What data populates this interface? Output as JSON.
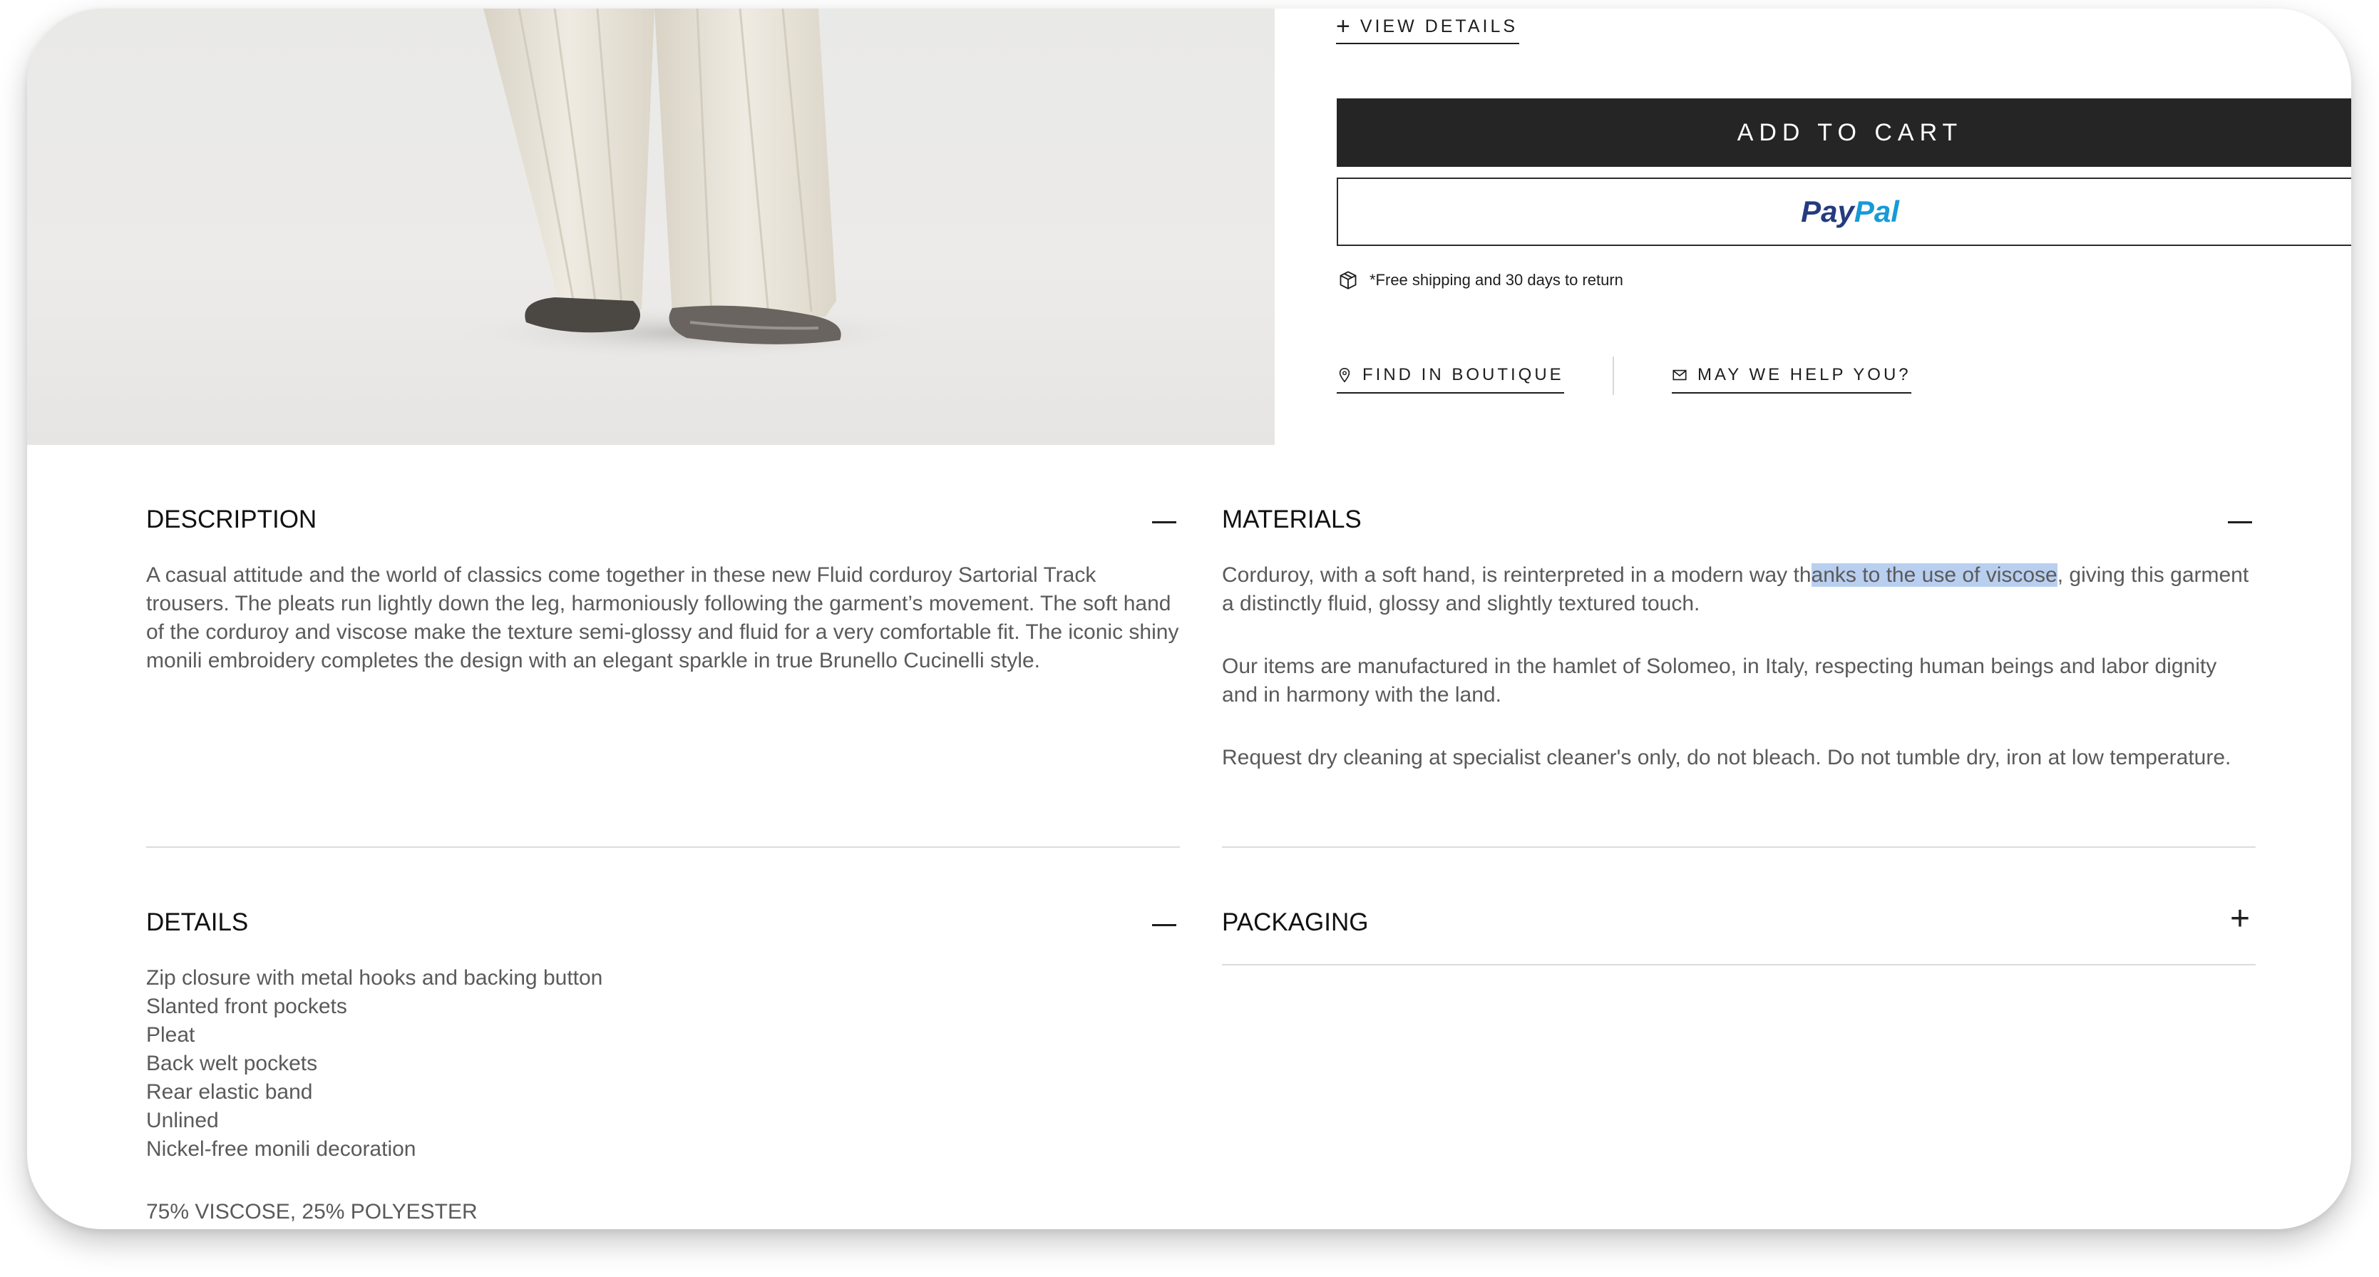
{
  "purchase": {
    "view_details": "VIEW DETAILS",
    "add_to_cart": "ADD TO CART",
    "paypal": {
      "pay": "Pay",
      "pal": "Pal"
    },
    "shipping_note": "*Free shipping and 30 days to return",
    "find_in_boutique": "FIND IN BOUTIQUE",
    "may_we_help": "MAY WE HELP YOU?"
  },
  "description": {
    "title": "DESCRIPTION",
    "text": "A casual attitude and the world of classics come together in these new Fluid corduroy Sartorial Track trousers. The pleats run lightly down the leg, harmoniously following the garment’s movement. The soft hand of the corduroy and viscose make the texture semi-glossy and fluid for a very comfortable fit. The iconic shiny monili embroidery completes the design with an elegant sparkle in true Brunello Cucinelli style."
  },
  "materials": {
    "title": "MATERIALS",
    "p1_before": "Corduroy, with a soft hand, is reinterpreted in a modern way th",
    "p1_selected": "anks to the use of viscose",
    "p1_after": ", giving this garment a distinctly fluid, glossy and slightly textured touch.",
    "p2": "Our items are manufactured in the hamlet of Solomeo, in Italy, respecting human beings and labor dignity and in harmony with the land.",
    "p3": "Request dry cleaning at specialist cleaner's only, do not bleach. Do not tumble dry, iron at low temperature."
  },
  "details": {
    "title": "DETAILS",
    "items": [
      "Zip closure with metal hooks and backing button",
      "Slanted front pockets",
      "Pleat",
      "Back welt pockets",
      "Rear elastic band",
      "Unlined",
      "Nickel-free monili decoration"
    ],
    "composition": "75% VISCOSE, 25% POLYESTER"
  },
  "packaging": {
    "title": "PACKAGING"
  },
  "icons": {
    "view_details": "plus-icon",
    "shipping": "box-icon",
    "boutique": "location-pin-icon",
    "help": "envelope-icon",
    "collapse": "minus-icon",
    "expand": "plus-icon"
  },
  "colors": {
    "button_dark": "#252525",
    "selection": "#b9cff0",
    "paypal_blue": "#253b80",
    "paypal_light": "#179bd7"
  }
}
